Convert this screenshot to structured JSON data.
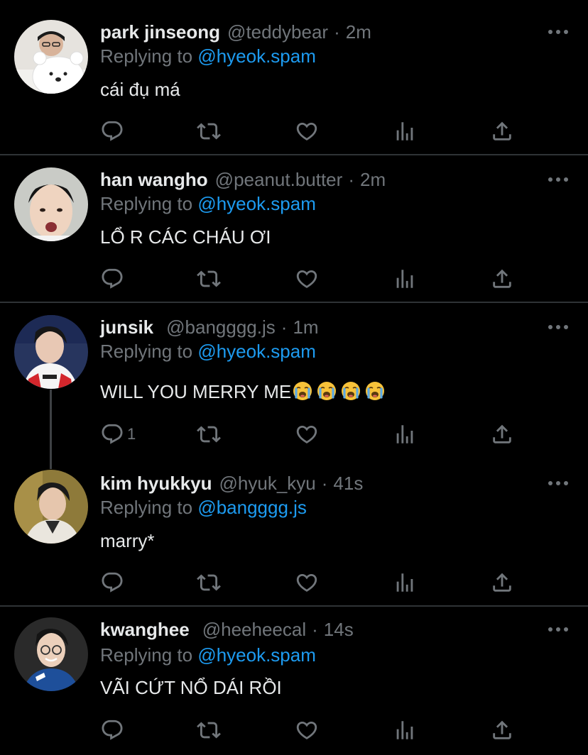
{
  "replying_prefix": "Replying to",
  "tweets": [
    {
      "name": "park jinseong",
      "handle": "@teddybear",
      "time": "2m",
      "replying_to": "@hyeok.spam",
      "text": "cái đụ má",
      "reply_count": ""
    },
    {
      "name": "han wangho",
      "handle": "@peanut.butter",
      "time": "2m",
      "replying_to": "@hyeok.spam",
      "text": "LỔ R CÁC CHÁU ƠI",
      "reply_count": ""
    },
    {
      "name": "junsik",
      "handle": "@bangggg.js",
      "time": "1m",
      "replying_to": "@hyeok.spam",
      "text": "WILL YOU MERRY ME",
      "emojis": [
        "loudly-crying-face",
        "loudly-crying-face",
        "loudly-crying-face",
        "loudly-crying-face"
      ],
      "reply_count": "1"
    },
    {
      "name": "kim hyukkyu",
      "handle": "@hyuk_kyu",
      "time": "41s",
      "replying_to": "@bangggg.js",
      "text": "marry*",
      "reply_count": ""
    },
    {
      "name": "kwanghee",
      "handle": "@heeheecal",
      "time": "14s",
      "replying_to": "@hyeok.spam",
      "text": "VÃI CỨT NỔ DÁI RỒI",
      "reply_count": ""
    }
  ],
  "dot_separator": "·",
  "icons": [
    "reply-icon",
    "retweet-icon",
    "like-icon",
    "views-icon",
    "share-icon",
    "more-icon"
  ],
  "colors": {
    "background": "#000000",
    "text": "#e7e9ea",
    "muted": "#71767b",
    "link": "#1d9bf0",
    "divider": "#2f3336"
  }
}
